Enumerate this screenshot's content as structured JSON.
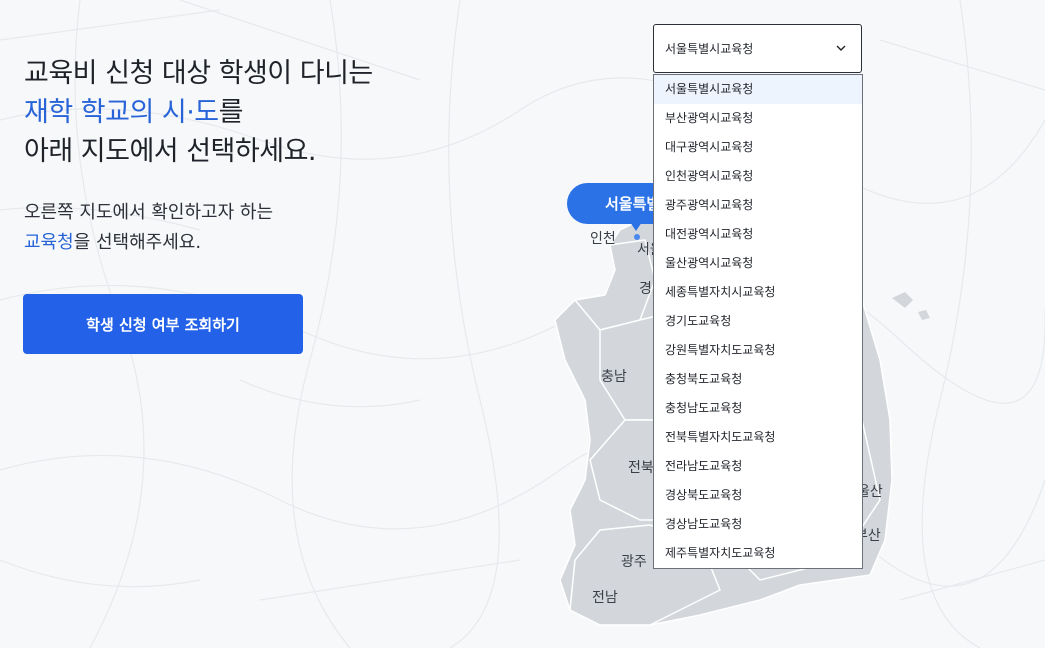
{
  "headline": {
    "line1": "교육비 신청 대상 학생이 다니는",
    "line2_accent": "재학 학교의 시·도",
    "line2_rest": "를",
    "line3": "아래 지도에서 선택하세요."
  },
  "subtext": {
    "line1": "오른쪽 지도에서 확인하고자 하는",
    "line2_accent": "교육청",
    "line2_rest": "을 선택해주세요."
  },
  "cta_label": "학생 신청 여부 조회하기",
  "map": {
    "pin_label": "서울특별시",
    "regions": [
      {
        "id": "incheon",
        "label": "인천"
      },
      {
        "id": "seoul",
        "label": "서울"
      },
      {
        "id": "gyeonggi",
        "label": "경기"
      },
      {
        "id": "chungnam",
        "label": "충남"
      },
      {
        "id": "jeonbuk",
        "label": "전북"
      },
      {
        "id": "gwangju",
        "label": "광주"
      },
      {
        "id": "jeonnam",
        "label": "전남"
      },
      {
        "id": "ulsan",
        "label": "울산"
      },
      {
        "id": "busan",
        "label": "부산"
      }
    ]
  },
  "select": {
    "value": "서울특별시교육청",
    "icon": "chevron-down-icon",
    "options": [
      "서울특별시교육청",
      "부산광역시교육청",
      "대구광역시교육청",
      "인천광역시교육청",
      "광주광역시교육청",
      "대전광역시교육청",
      "울산광역시교육청",
      "세종특별자치시교육청",
      "경기도교육청",
      "강원특별자치도교육청",
      "충청북도교육청",
      "충청남도교육청",
      "전북특별자치도교육청",
      "전라남도교육청",
      "경상북도교육청",
      "경상남도교육청",
      "제주특별자치도교육청"
    ]
  },
  "colors": {
    "accent": "#2864d8",
    "cta": "#2361e8",
    "pin": "#2a72e6",
    "map_land": "#d3d7dc",
    "map_border": "#ffffff"
  }
}
